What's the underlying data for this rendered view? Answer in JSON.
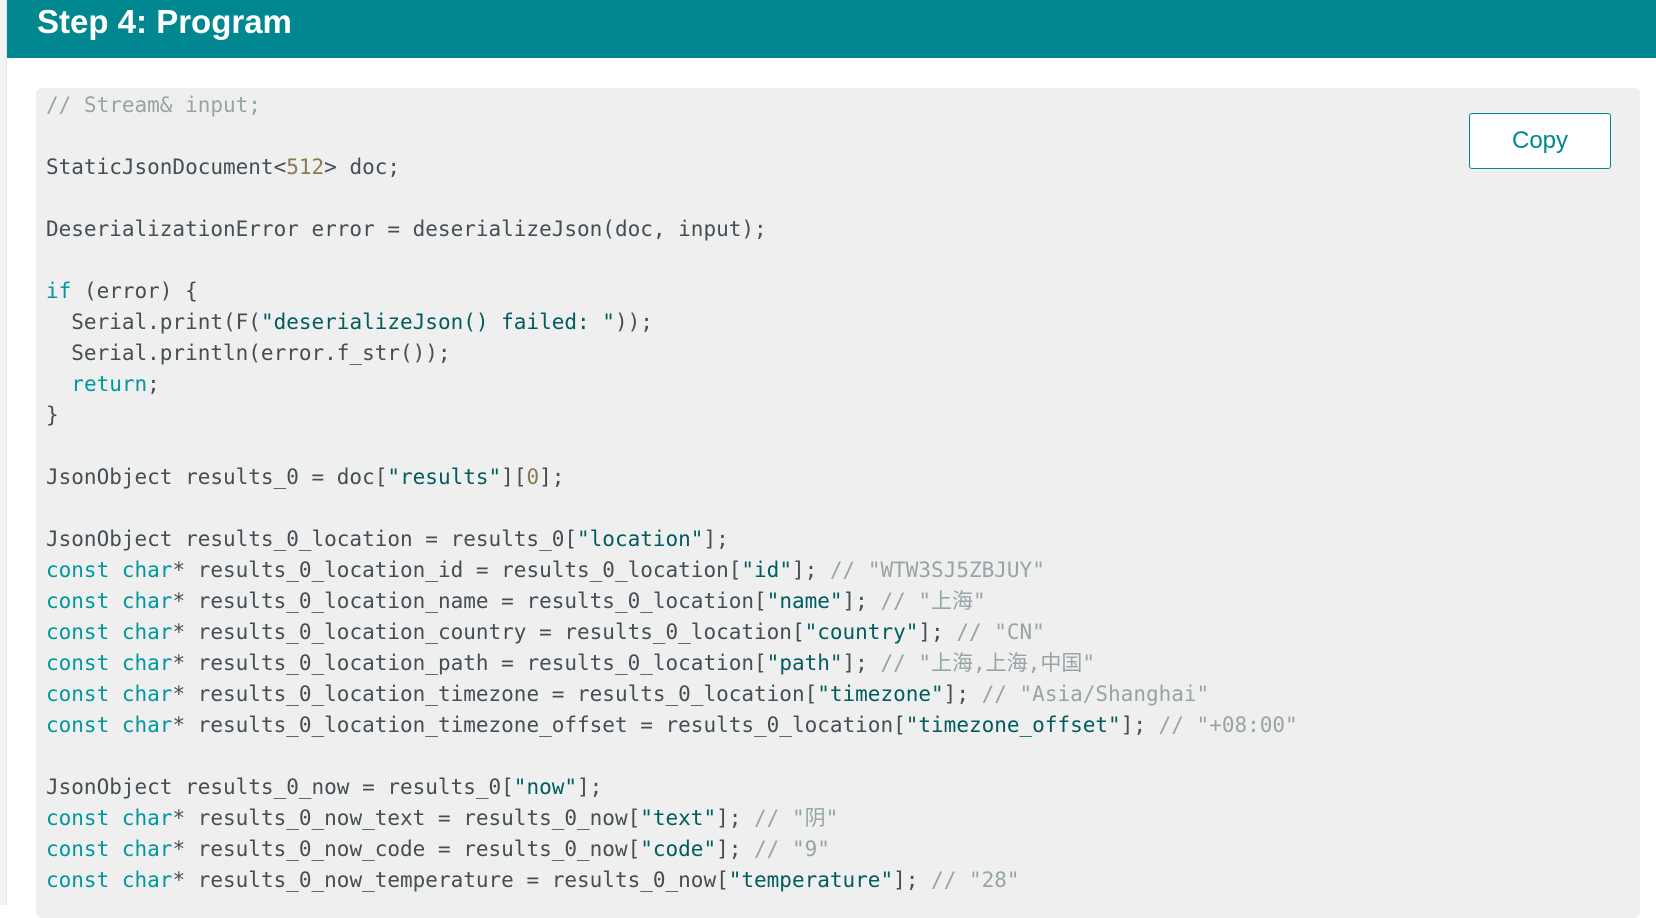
{
  "header": {
    "title": "Step 4: Program"
  },
  "toolbar": {
    "copy_label": "Copy"
  },
  "colors": {
    "header_bg": "#00878f",
    "code_bg": "#efefef",
    "keyword": "#00979d",
    "string": "#005c5f",
    "number": "#8a7b52",
    "comment": "#95a5a6",
    "plain": "#434f54"
  },
  "code": {
    "lines": [
      [
        {
          "t": "cmt",
          "v": "// Stream& input;"
        }
      ],
      [],
      [
        {
          "t": "plain",
          "v": "StaticJsonDocument<"
        },
        {
          "t": "num",
          "v": "512"
        },
        {
          "t": "plain",
          "v": "> doc;"
        }
      ],
      [],
      [
        {
          "t": "plain",
          "v": "DeserializationError error = deserializeJson(doc, input);"
        }
      ],
      [],
      [
        {
          "t": "kw",
          "v": "if"
        },
        {
          "t": "plain",
          "v": " (error) {"
        }
      ],
      [
        {
          "t": "plain",
          "v": "  Serial.print(F("
        },
        {
          "t": "str",
          "v": "\"deserializeJson() failed: \""
        },
        {
          "t": "plain",
          "v": "));"
        }
      ],
      [
        {
          "t": "plain",
          "v": "  Serial.println(error.f_str());"
        }
      ],
      [
        {
          "t": "plain",
          "v": "  "
        },
        {
          "t": "kw",
          "v": "return"
        },
        {
          "t": "plain",
          "v": ";"
        }
      ],
      [
        {
          "t": "plain",
          "v": "}"
        }
      ],
      [],
      [
        {
          "t": "plain",
          "v": "JsonObject results_0 = doc["
        },
        {
          "t": "str",
          "v": "\"results\""
        },
        {
          "t": "plain",
          "v": "]["
        },
        {
          "t": "num",
          "v": "0"
        },
        {
          "t": "plain",
          "v": "];"
        }
      ],
      [],
      [
        {
          "t": "plain",
          "v": "JsonObject results_0_location = results_0["
        },
        {
          "t": "str",
          "v": "\"location\""
        },
        {
          "t": "plain",
          "v": "];"
        }
      ],
      [
        {
          "t": "kw",
          "v": "const char"
        },
        {
          "t": "plain",
          "v": "* results_0_location_id = results_0_location["
        },
        {
          "t": "str",
          "v": "\"id\""
        },
        {
          "t": "plain",
          "v": "]; "
        },
        {
          "t": "cmt",
          "v": "// \"WTW3SJ5ZBJUY\""
        }
      ],
      [
        {
          "t": "kw",
          "v": "const char"
        },
        {
          "t": "plain",
          "v": "* results_0_location_name = results_0_location["
        },
        {
          "t": "str",
          "v": "\"name\""
        },
        {
          "t": "plain",
          "v": "]; "
        },
        {
          "t": "cmt",
          "v": "// \"上海\""
        }
      ],
      [
        {
          "t": "kw",
          "v": "const char"
        },
        {
          "t": "plain",
          "v": "* results_0_location_country = results_0_location["
        },
        {
          "t": "str",
          "v": "\"country\""
        },
        {
          "t": "plain",
          "v": "]; "
        },
        {
          "t": "cmt",
          "v": "// \"CN\""
        }
      ],
      [
        {
          "t": "kw",
          "v": "const char"
        },
        {
          "t": "plain",
          "v": "* results_0_location_path = results_0_location["
        },
        {
          "t": "str",
          "v": "\"path\""
        },
        {
          "t": "plain",
          "v": "]; "
        },
        {
          "t": "cmt",
          "v": "// \"上海,上海,中国\""
        }
      ],
      [
        {
          "t": "kw",
          "v": "const char"
        },
        {
          "t": "plain",
          "v": "* results_0_location_timezone = results_0_location["
        },
        {
          "t": "str",
          "v": "\"timezone\""
        },
        {
          "t": "plain",
          "v": "]; "
        },
        {
          "t": "cmt",
          "v": "// \"Asia/Shanghai\""
        }
      ],
      [
        {
          "t": "kw",
          "v": "const char"
        },
        {
          "t": "plain",
          "v": "* results_0_location_timezone_offset = results_0_location["
        },
        {
          "t": "str",
          "v": "\"timezone_offset\""
        },
        {
          "t": "plain",
          "v": "]; "
        },
        {
          "t": "cmt",
          "v": "// \"+08:00\""
        }
      ],
      [],
      [
        {
          "t": "plain",
          "v": "JsonObject results_0_now = results_0["
        },
        {
          "t": "str",
          "v": "\"now\""
        },
        {
          "t": "plain",
          "v": "];"
        }
      ],
      [
        {
          "t": "kw",
          "v": "const char"
        },
        {
          "t": "plain",
          "v": "* results_0_now_text = results_0_now["
        },
        {
          "t": "str",
          "v": "\"text\""
        },
        {
          "t": "plain",
          "v": "]; "
        },
        {
          "t": "cmt",
          "v": "// \"阴\""
        }
      ],
      [
        {
          "t": "kw",
          "v": "const char"
        },
        {
          "t": "plain",
          "v": "* results_0_now_code = results_0_now["
        },
        {
          "t": "str",
          "v": "\"code\""
        },
        {
          "t": "plain",
          "v": "]; "
        },
        {
          "t": "cmt",
          "v": "// \"9\""
        }
      ],
      [
        {
          "t": "kw",
          "v": "const char"
        },
        {
          "t": "plain",
          "v": "* results_0_now_temperature = results_0_now["
        },
        {
          "t": "str",
          "v": "\"temperature\""
        },
        {
          "t": "plain",
          "v": "]; "
        },
        {
          "t": "cmt",
          "v": "// \"28\""
        }
      ]
    ]
  }
}
